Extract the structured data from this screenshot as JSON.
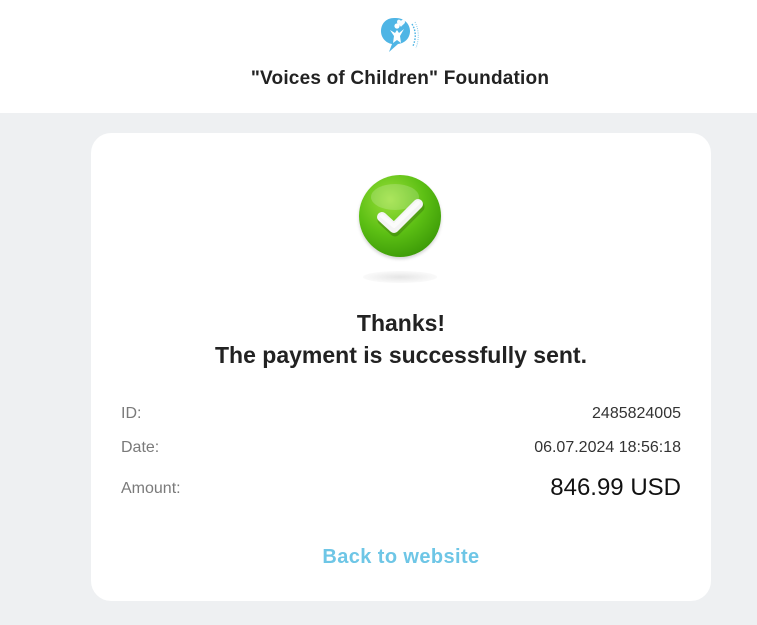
{
  "header": {
    "logo_icon": "foundation-logo-icon",
    "title": "\"Voices of Children\" Foundation"
  },
  "card": {
    "status_icon": "success-checkmark-icon",
    "thanks": "Thanks!",
    "message": "The payment is successfully sent.",
    "details": {
      "id_label": "ID:",
      "id_value": "2485824005",
      "date_label": "Date:",
      "date_value": "06.07.2024 18:56:18",
      "amount_label": "Amount:",
      "amount_value": "846.99 USD"
    },
    "back_link": "Back to website"
  },
  "colors": {
    "page_background": "#eef0f2",
    "card_background": "#ffffff",
    "success_green": "#5cbf14",
    "link_blue": "#6ec6e6",
    "logo_blue": "#4fb5e5"
  }
}
